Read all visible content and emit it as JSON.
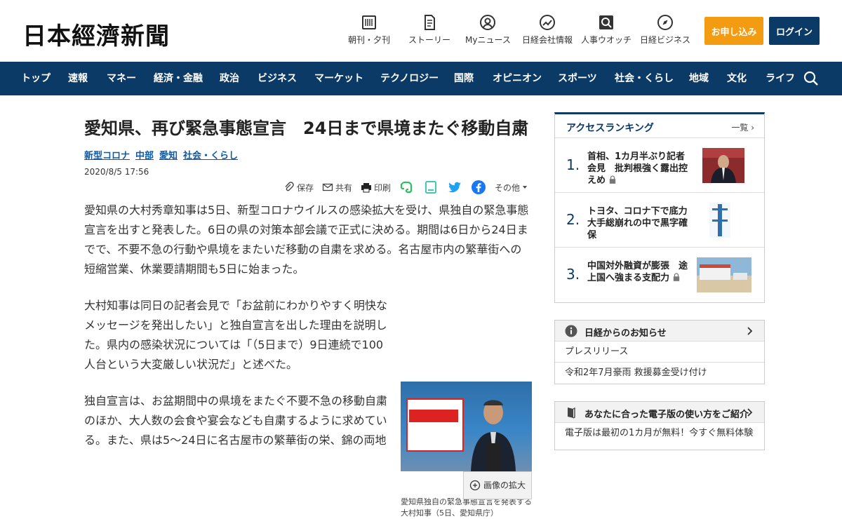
{
  "header": {
    "logo": "日本經濟新聞",
    "utils": [
      {
        "label": "朝刊・夕刊",
        "icon": "newspaper-icon"
      },
      {
        "label": "ストーリー",
        "icon": "document-icon"
      },
      {
        "label": "Myニュース",
        "icon": "user-icon"
      },
      {
        "label": "日経会社情報",
        "icon": "chart-icon"
      },
      {
        "label": "人事ウオッチ",
        "icon": "magnifier-icon"
      },
      {
        "label": "日経ビジネス",
        "icon": "compass-icon"
      }
    ],
    "apply_label": "お申し込み",
    "login_label": "ログイン"
  },
  "nav": {
    "items": [
      "トップ",
      "速報",
      "マネー",
      "経済・金融",
      "政治",
      "ビジネス",
      "マーケット",
      "テクノロジー",
      "国際",
      "オピニオン",
      "スポーツ",
      "社会・くらし",
      "地域",
      "文化",
      "ライフ"
    ]
  },
  "article": {
    "title": "愛知県、再び緊急事態宣言　24日まで県境またぐ移動自粛",
    "tags": [
      "新型コロナ",
      "中部",
      "愛知",
      "社会・くらし"
    ],
    "date": "2020/8/5 17:56",
    "share": {
      "save": "保存",
      "share": "共有",
      "print": "印刷",
      "more": "その他"
    },
    "paragraphs": [
      "愛知県の大村秀章知事は5日、新型コロナウイルスの感染拡大を受け、県独自の緊急事態宣言を出すと発表した。6日の県の対策本部会議で正式に決める。期間は6日から24日までで、不要不急の行動や県境をまたいだ移動の自粛を求める。名古屋市内の繁華街への短縮営業、休業要請期間も5日に始まった。",
      "大村知事は同日の記者会見で「お盆前にわかりやすく明快なメッセージを発出したい」と独自宣言を出した理由を説明した。県内の感染状況については「（5日まで）9日連続で100人台という大変厳しい状況だ」と述べた。",
      "独自宣言は、お盆期間中の県境をまたぐ不要不急の移動自粛のほか、大人数の会食や宴会なども自粛するように求めている。また、県は5～24日に名古屋市の繁華街の栄、錦の両地"
    ],
    "figure": {
      "zoom_label": "画像の拡大",
      "caption": "愛知県独自の緊急事態宣言を発表する大村知事（5日、愛知県庁）"
    }
  },
  "ranking": {
    "title": "アクセスランキング",
    "more": "一覧",
    "items": [
      {
        "rank": "1.",
        "text": "首相、1カ月半ぶり記者会見　批判根強く露出控えめ",
        "locked": true
      },
      {
        "rank": "2.",
        "text": "トヨタ、コロナ下で底力　大手総崩れの中で黒字確保",
        "locked": false
      },
      {
        "rank": "3.",
        "text": "中国対外融資が膨張　途上国へ強まる支配力",
        "locked": true
      }
    ]
  },
  "notice": {
    "title": "日経からのお知らせ",
    "rows": [
      "プレスリリース",
      "令和2年7月豪雨 救援募金受け付け"
    ]
  },
  "digital": {
    "title": "あなたに合った電子版の使い方をご紹介",
    "rows": [
      "電子版は最初の1カ月が無料！今すぐ無料体験"
    ]
  },
  "colors": {
    "brand_navy": "#0b3a66",
    "apply_orange": "#f39c12",
    "link_blue": "#0b5aa8"
  }
}
